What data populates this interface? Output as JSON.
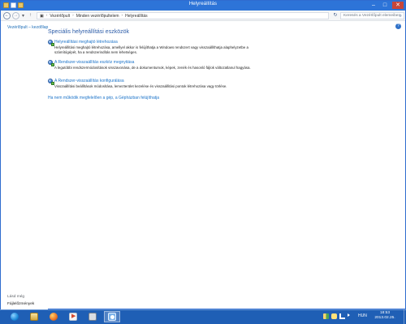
{
  "window": {
    "title": "Helyreállítás"
  },
  "addressbar": {
    "breadcrumbs": [
      "Vezérlőpult",
      "Minden vezérlőpultelem",
      "Helyreállítás"
    ],
    "search_placeholder": "Keresés a Vezérlőpult elemeiben"
  },
  "sidebar": {
    "home_link": "Vezérlőpult – kezdőlap",
    "see_also_title": "Lásd még",
    "see_also_item": "Fájlelőzmények"
  },
  "main": {
    "heading": "Speciális helyreállítási eszközök",
    "tools": [
      {
        "title": "Helyreállítási meghajtó létrehozása",
        "description": "Helyreállítási meghajtó létrehozása, amellyel akkor is felújíthatja a Windows rendszert vagy visszaállíthatja alaphelyzetbe a számítógépét, ha a rendszerindítás nem lehetséges."
      },
      {
        "title": "A Rendszer-visszaállítás eszköz megnyitása",
        "description": "A legutóbbi rendszermódosítások visszavonása, de a dokumentumok, képek, zenék és hasonló fájlok változatlanul hagyása."
      },
      {
        "title": "A Rendszer-visszaállítás konfigurálása",
        "description": "Visszaállítási beállítások módosítása, lemezterület kezelése és visszaállítási pontok létrehozása vagy törlése."
      }
    ],
    "help_link": "Ha nem működik megfelelően a gép, a Gépházban felújíthatja"
  },
  "taskbar": {
    "language": "HUN",
    "time": "18:53",
    "date": "2013.02.25."
  }
}
